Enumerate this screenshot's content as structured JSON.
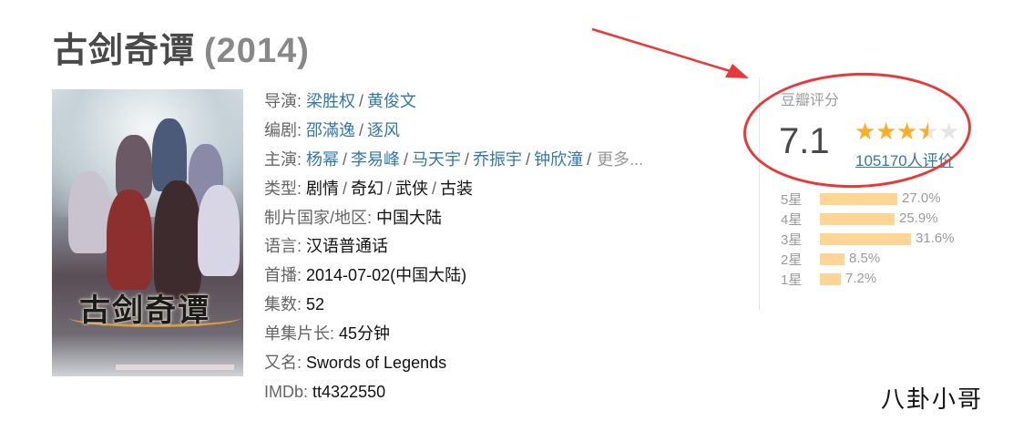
{
  "title": {
    "name": "古剑奇谭",
    "year": "(2014)"
  },
  "poster": {
    "logo_text": "古剑奇谭"
  },
  "info": {
    "director_label": "导演",
    "directors": [
      "梁胜权",
      "黄俊文"
    ],
    "writer_label": "编剧",
    "writers": [
      "邵滿逸",
      "逐风"
    ],
    "cast_label": "主演",
    "cast": [
      "杨幂",
      "李易峰",
      "马天宇",
      "乔振宇",
      "钟欣潼"
    ],
    "more": "更多...",
    "genre_label": "类型",
    "genres": [
      "剧情",
      "奇幻",
      "武侠",
      "古装"
    ],
    "country_label": "制片国家/地区",
    "country": "中国大陆",
    "language_label": "语言",
    "language": "汉语普通话",
    "premiere_label": "首播",
    "premiere": "2014-07-02(中国大陆)",
    "episodes_label": "集数",
    "episodes": "52",
    "runtime_label": "单集片长",
    "runtime": "45分钟",
    "aka_label": "又名",
    "aka": "Swords of Legends",
    "imdb_label": "IMDb",
    "imdb": "tt4322550"
  },
  "rating": {
    "label": "豆瓣评分",
    "score": "7.1",
    "stars": 3.5,
    "count": "105170人评价",
    "distribution": [
      {
        "star": "5星",
        "percent": "27.0%",
        "value": 27.0
      },
      {
        "star": "4星",
        "percent": "25.9%",
        "value": 25.9
      },
      {
        "star": "3星",
        "percent": "31.6%",
        "value": 31.6
      },
      {
        "star": "2星",
        "percent": "8.5%",
        "value": 8.5
      },
      {
        "star": "1星",
        "percent": "7.2%",
        "value": 7.2
      }
    ]
  },
  "annotation": {
    "color": "#e8393a"
  },
  "colors": {
    "link": "#3377aa",
    "star": "#ffad23",
    "bar": "#ffd596"
  },
  "watermark": "八卦小哥"
}
